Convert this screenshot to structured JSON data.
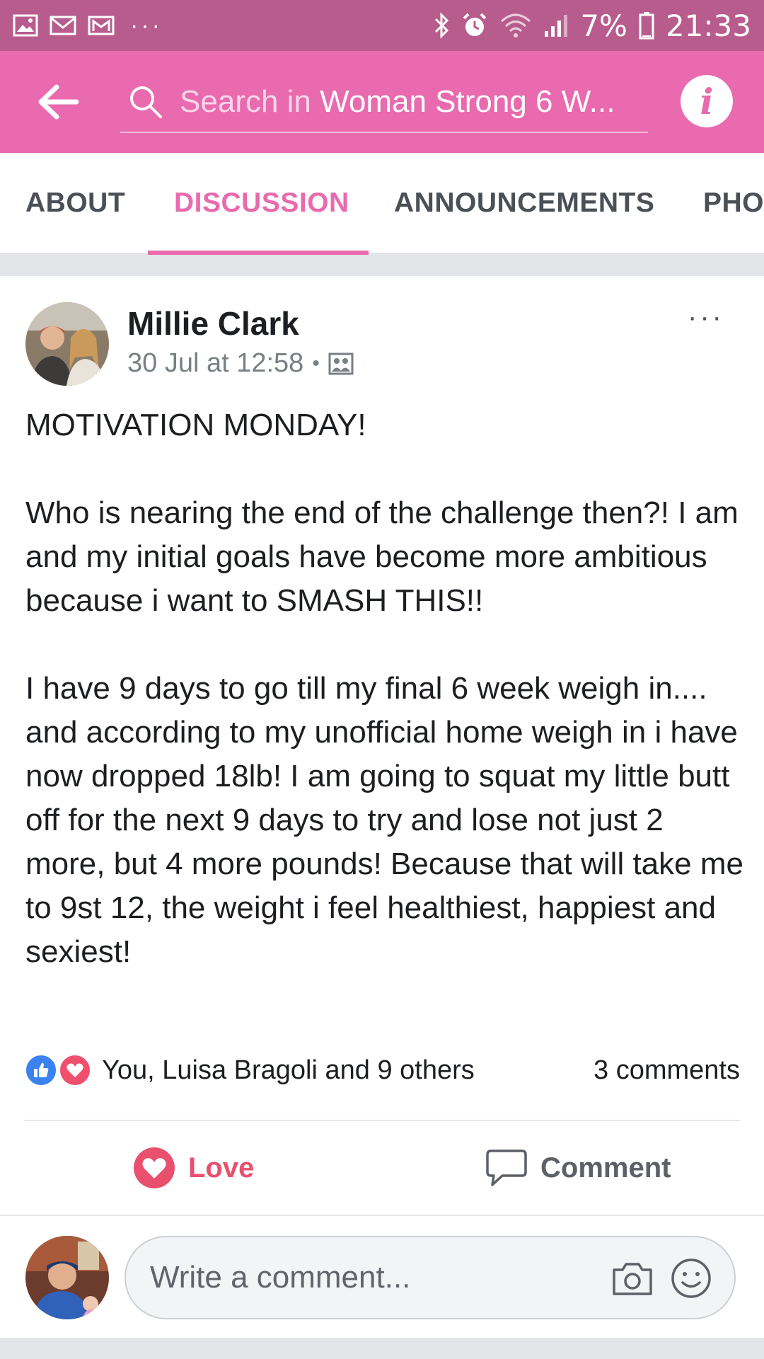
{
  "status_bar": {
    "battery": "7%",
    "time": "21:33",
    "more": "···",
    "left_icons": [
      "gallery-icon",
      "mail-icon",
      "gmail-icon"
    ],
    "right_icons": [
      "bluetooth-icon",
      "alarm-icon",
      "wifi-icon",
      "signal-icon",
      "battery-icon"
    ]
  },
  "app_bar": {
    "search_placeholder": "Search in ",
    "search_group": "Woman Strong 6 W...",
    "info_label": "i"
  },
  "tabs": [
    {
      "label": "ABOUT"
    },
    {
      "label": "DISCUSSION",
      "active": true
    },
    {
      "label": "ANNOUNCEMENTS"
    },
    {
      "label": "PHO"
    }
  ],
  "post": {
    "author": "Millie Clark",
    "timestamp": "30 Jul at 12:58",
    "meta_separator": "•",
    "more_label": "···",
    "body": [
      "MOTIVATION MONDAY!",
      "Who is nearing the end of the challenge then?! I am and my initial goals have become more ambitious because i want to SMASH THIS!!",
      "I have 9 days to go till my final 6 week weigh in.... and according to my unofficial home weigh in i have now dropped 18lb! I am going to squat my little butt off for the next 9 days to try and lose not just 2 more, but 4 more pounds! Because that will take me to 9st 12, the weight i feel healthiest, happiest and sexiest!"
    ],
    "reactions_text": "You, Luisa Bragoli and 9 others",
    "comments_count": "3 comments",
    "actions": {
      "love": "Love",
      "comment": "Comment"
    }
  },
  "composer": {
    "placeholder": "Write a comment..."
  },
  "colors": {
    "status_bar": "#b85c8e",
    "app_bar": "#e96aae",
    "accent_pink": "#e96aae",
    "love_red": "#e9506d",
    "like_blue": "#3b82f0"
  }
}
